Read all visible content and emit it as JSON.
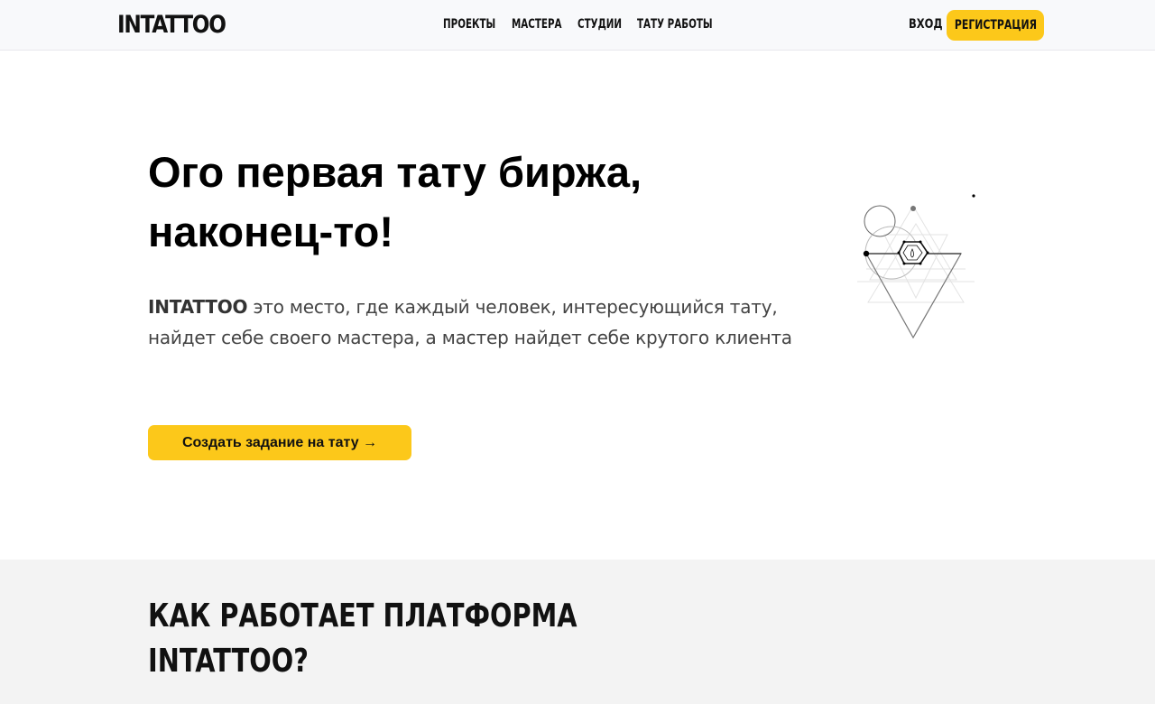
{
  "header": {
    "logo": "INTATTOO",
    "nav": [
      "ПРОЕКТЫ",
      "МАСТЕРА",
      "СТУДИИ",
      "ТАТУ РАБОТЫ"
    ],
    "login": "ВХОД",
    "register": "РЕГИСТРАЦИЯ"
  },
  "hero": {
    "title": "Ого первая тату биржа, наконец-то!",
    "brand": "INTATTOO",
    "description": " это место, где каждый человек, интересующийся тату, найдет себе своего мастера, а мастер найдет себе крутого клиента",
    "cta": "Создать задание на тату →"
  },
  "how_it_works": {
    "title": "КАК РАБОТАЕТ ПЛАТФОРМА INTATTOO?"
  },
  "colors": {
    "accent": "#fcc81a",
    "header_bg": "#f8f9fb",
    "section_bg": "#f3f3f3"
  }
}
